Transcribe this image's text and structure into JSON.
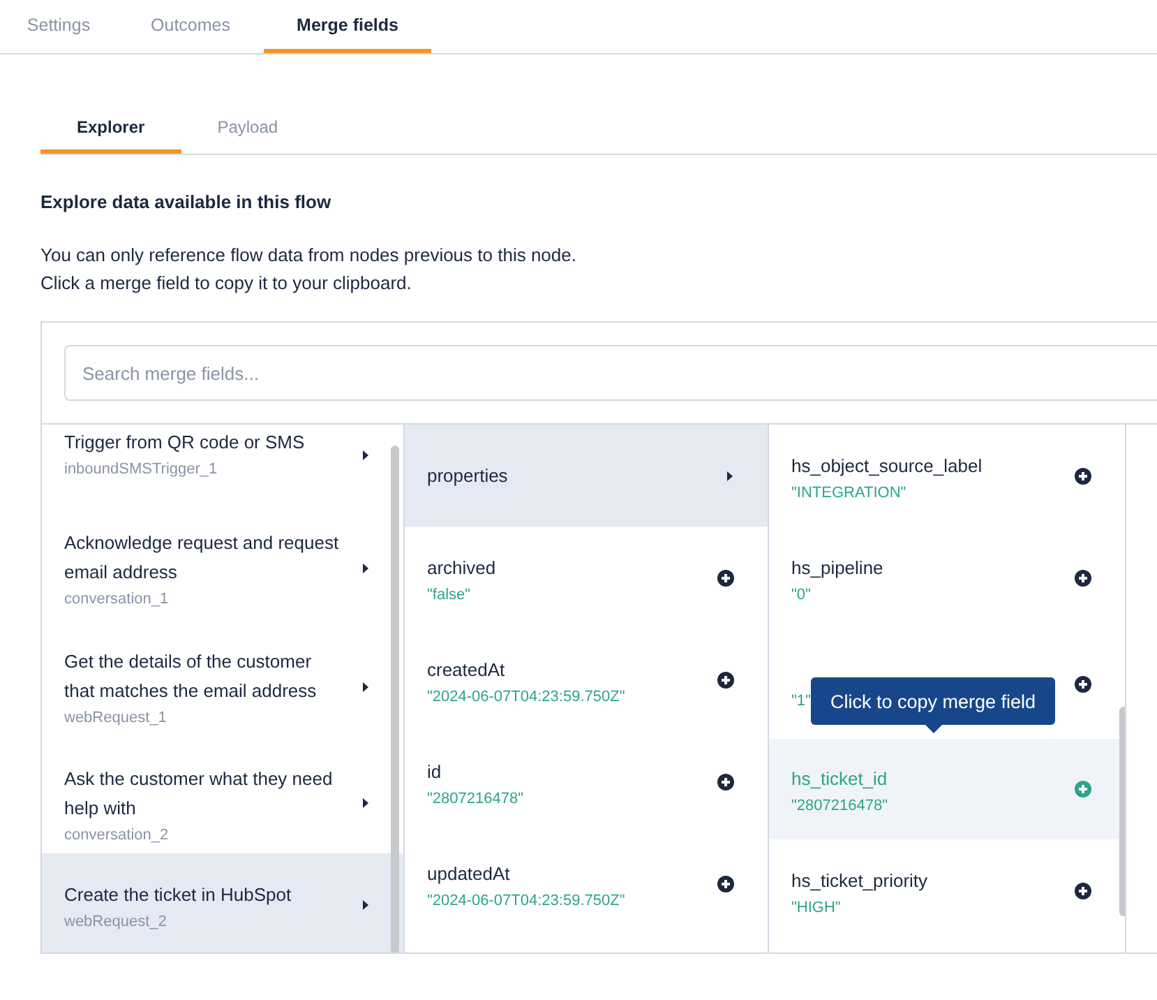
{
  "main_tabs": [
    {
      "label": "Settings",
      "selected": false
    },
    {
      "label": "Outcomes",
      "selected": false
    },
    {
      "label": "Merge fields",
      "selected": true
    }
  ],
  "sub_tabs": [
    {
      "label": "Explorer",
      "selected": true
    },
    {
      "label": "Payload",
      "selected": false
    }
  ],
  "heading": "Explore data available in this flow",
  "description": [
    "You can only reference flow data from nodes previous to this node.",
    "Click a merge field to copy it to your clipboard."
  ],
  "search": {
    "placeholder": "Search merge fields..."
  },
  "steps": [
    {
      "title": "Trigger from QR code or SMS",
      "id": "inboundSMSTrigger_1",
      "selected": false
    },
    {
      "title": "Acknowledge request and request email address",
      "id": "conversation_1",
      "selected": false
    },
    {
      "title": "Get the details of the customer that matches the email address",
      "id": "webRequest_1",
      "selected": false
    },
    {
      "title": "Ask the customer what they need help with",
      "id": "conversation_2",
      "selected": false
    },
    {
      "title": "Create the ticket in HubSpot",
      "id": "webRequest_2",
      "selected": true
    }
  ],
  "fields": [
    {
      "kind": "object",
      "name": "properties",
      "selected": true
    },
    {
      "kind": "value",
      "name": "archived",
      "value": "\"false\"",
      "selected": false
    },
    {
      "kind": "value",
      "name": "createdAt",
      "value": "\"2024-06-07T04:23:59.750Z\"",
      "selected": false
    },
    {
      "kind": "value",
      "name": "id",
      "value": "\"2807216478\"",
      "selected": false
    },
    {
      "kind": "value",
      "name": "updatedAt",
      "value": "\"2024-06-07T04:23:59.750Z\"",
      "selected": false
    }
  ],
  "properties": [
    {
      "name": "hs_object_source_label",
      "value": "\"INTEGRATION\"",
      "hovered": false
    },
    {
      "name": "hs_pipeline",
      "value": "\"0\"",
      "hovered": false
    },
    {
      "value": "\"1\"",
      "hovered": false
    },
    {
      "name": "hs_ticket_id",
      "value": "\"2807216478\"",
      "hovered": true
    },
    {
      "name": "hs_ticket_priority",
      "value": "\"HIGH\"",
      "hovered": false
    }
  ],
  "tooltip": "Click to copy merge field"
}
